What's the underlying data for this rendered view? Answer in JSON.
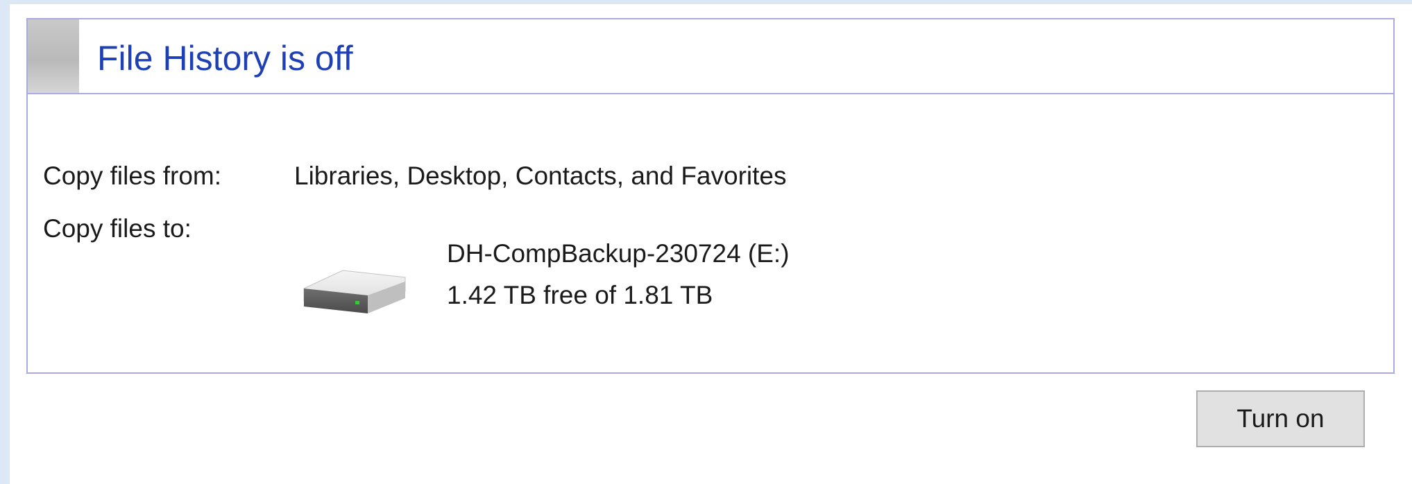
{
  "panel": {
    "title": "File History is off"
  },
  "copy_from": {
    "label": "Copy files from:",
    "value": "Libraries, Desktop, Contacts, and Favorites"
  },
  "copy_to": {
    "label": "Copy files to:",
    "drive_icon": "hard-drive-icon",
    "drive_name": "DH-CompBackup-230724 (E:)",
    "drive_space": "1.42 TB free of 1.81 TB"
  },
  "actions": {
    "turn_on_label": "Turn on"
  },
  "colors": {
    "title_text": "#1e40b4",
    "panel_border": "#a9aae3",
    "outer_background": "#dce8f6",
    "button_background": "#e1e1e1",
    "drive_led": "#3cc63c"
  }
}
